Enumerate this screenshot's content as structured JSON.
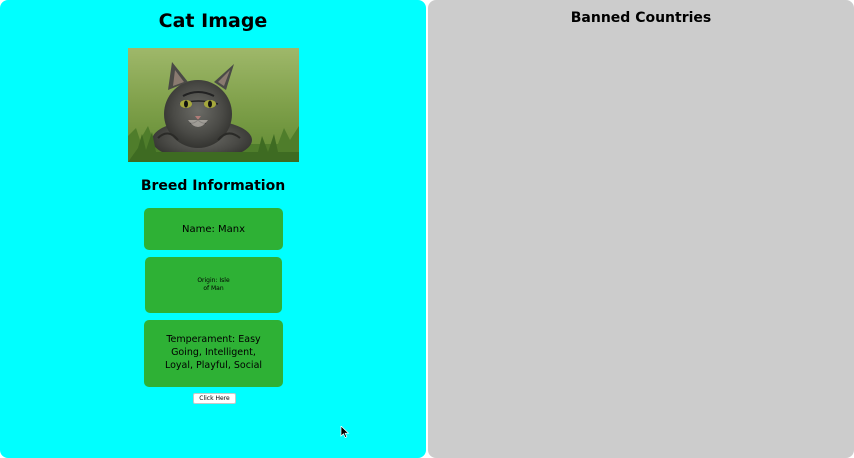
{
  "left_panel": {
    "title": "Cat Image",
    "image": {
      "alt": "cat photo"
    },
    "breed_heading": "Breed Information",
    "cards": {
      "name": "Name: Manx",
      "origin": "Origin: Isle of Man",
      "temperament": "Temperament: Easy Going, Intelligent, Loyal, Playful, Social"
    },
    "button_label": "Click Here"
  },
  "right_panel": {
    "title": "Banned Countries"
  },
  "colors": {
    "left_panel_bg": "#00ffff",
    "right_panel_bg": "#cccccc",
    "card_bg": "#2eb135"
  }
}
